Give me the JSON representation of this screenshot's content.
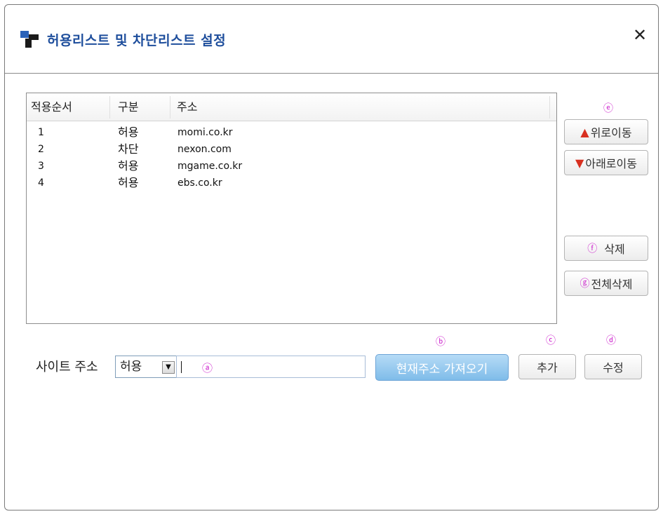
{
  "window": {
    "title": "허용리스트 및 차단리스트 설정",
    "close_label": "✕"
  },
  "list": {
    "columns": [
      "적용순서",
      "구분",
      "주소"
    ],
    "rows": [
      {
        "order": "1",
        "type": "허용",
        "address": "momi.co.kr"
      },
      {
        "order": "2",
        "type": "차단",
        "address": "nexon.com"
      },
      {
        "order": "3",
        "type": "허용",
        "address": "mgame.co.kr"
      },
      {
        "order": "4",
        "type": "허용",
        "address": "ebs.co.kr"
      }
    ]
  },
  "side_buttons": {
    "move_up_label": "위로이동",
    "move_down_label": "아래로이동",
    "delete_label": "삭제",
    "delete_all_label": "전체삭제",
    "move_up_arrow": "▲",
    "move_down_arrow": "▼"
  },
  "form": {
    "site_label": "사이트 주소",
    "select_value": "허용",
    "select_arrow": "▼",
    "fetch_label": "현재주소 가져오기",
    "add_label": "추가",
    "edit_label": "수정"
  },
  "markers": {
    "a": "ⓐ",
    "b": "ⓑ",
    "c": "ⓒ",
    "d": "ⓓ",
    "e": "ⓔ",
    "f": "ⓕ",
    "g": "ⓖ"
  },
  "colors": {
    "title_blue": "#1e4e9c",
    "marker_magenta": "#cc22cc",
    "arrow_red": "#d83020",
    "fetch_button_blue": "#7fbce9"
  }
}
